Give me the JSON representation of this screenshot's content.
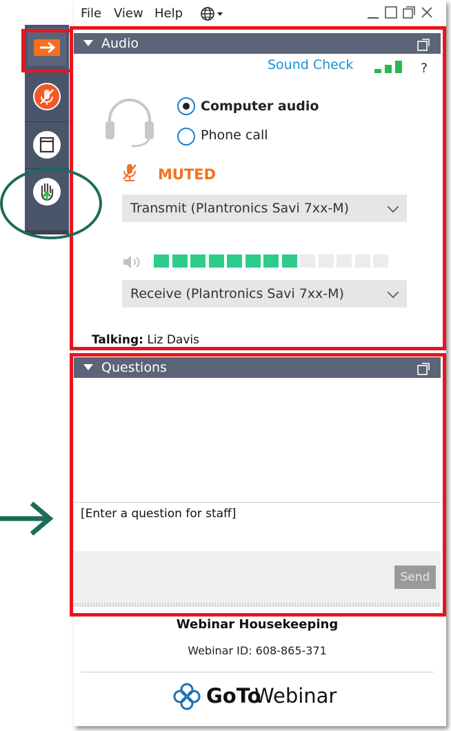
{
  "menu": {
    "file": "File",
    "view": "View",
    "help": "Help"
  },
  "audio": {
    "header": "Audio",
    "sound_check": "Sound Check",
    "help": "?",
    "computer_audio": "Computer audio",
    "phone_call": "Phone call",
    "selected_option": "computer_audio",
    "muted": "MUTED",
    "transmit": "Transmit (Plantronics Savi 7xx-M)",
    "receive": "Receive (Plantronics Savi 7xx-M)",
    "talking_label": "Talking:",
    "talking_name": "Liz Davis",
    "volume_level": 0.6
  },
  "questions": {
    "header": "Questions",
    "placeholder": "[Enter a question for staff]",
    "send": "Send"
  },
  "footer": {
    "title": "Webinar Housekeeping",
    "webinar_id": "Webinar ID: 608-865-371",
    "brand_bold": "GoTo",
    "brand_light": "Webinar"
  },
  "colors": {
    "accent_red": "#e8151f",
    "orange": "#f37021",
    "green": "#2ecc8a",
    "link_blue": "#1a8ed6",
    "annotation_green": "#1c6b58"
  },
  "icons": [
    "globe-icon",
    "arrow-right-icon",
    "microphone-muted-icon",
    "window-icon",
    "raise-hand-icon",
    "headset-icon",
    "speaker-icon",
    "popout-icon",
    "signal-bars-icon",
    "gotowebinar-logo-icon"
  ]
}
